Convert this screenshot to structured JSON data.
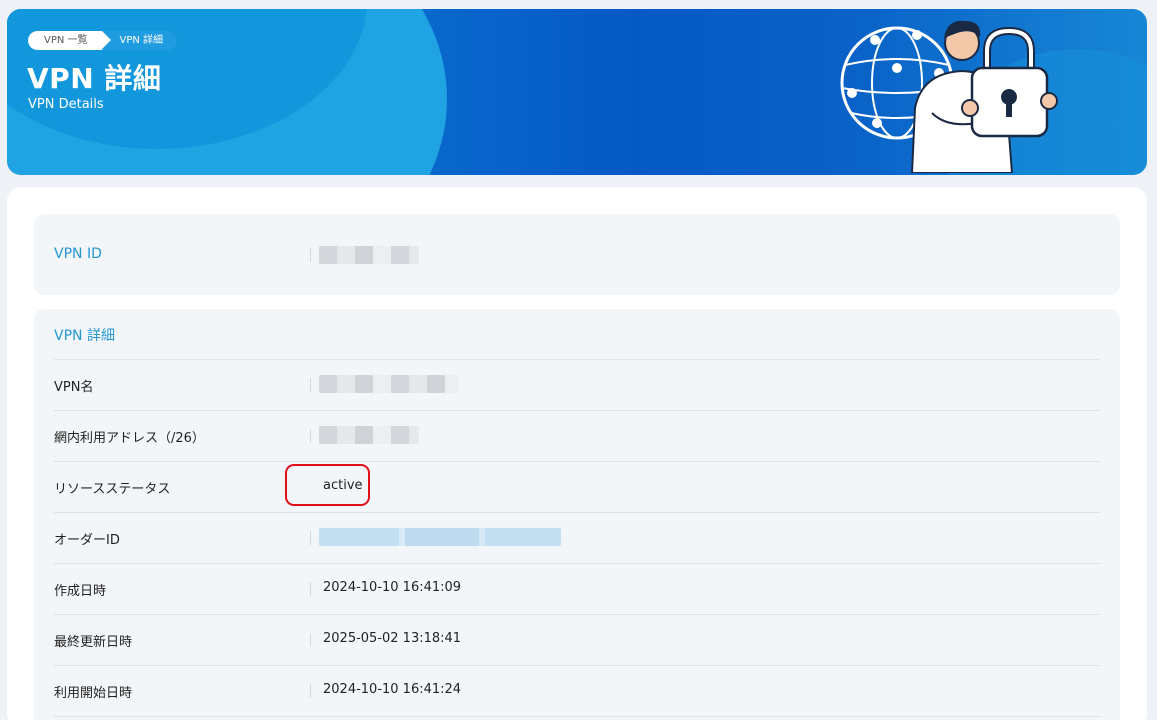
{
  "breadcrumb": {
    "items": [
      "VPN 一覧",
      "VPN 詳細"
    ]
  },
  "header": {
    "title": "VPN 詳細",
    "subtitle": "VPN Details"
  },
  "vpn_id": {
    "label": "VPN ID"
  },
  "details": {
    "title": "VPN 詳細",
    "rows": [
      {
        "key": "VPN名"
      },
      {
        "key": "網内利用アドレス（/26）"
      },
      {
        "key": "リソースステータス",
        "value": "active"
      },
      {
        "key": "オーダーID"
      },
      {
        "key": "作成日時",
        "value": "2024-10-10 16:41:09"
      },
      {
        "key": "最終更新日時",
        "value": "2025-05-02 13:18:41"
      },
      {
        "key": "利用開始日時",
        "value": "2024-10-10 16:41:24"
      }
    ]
  },
  "colors": {
    "accent": "#2596d0",
    "highlight": "#e0101a",
    "hero": "#0559c4"
  }
}
